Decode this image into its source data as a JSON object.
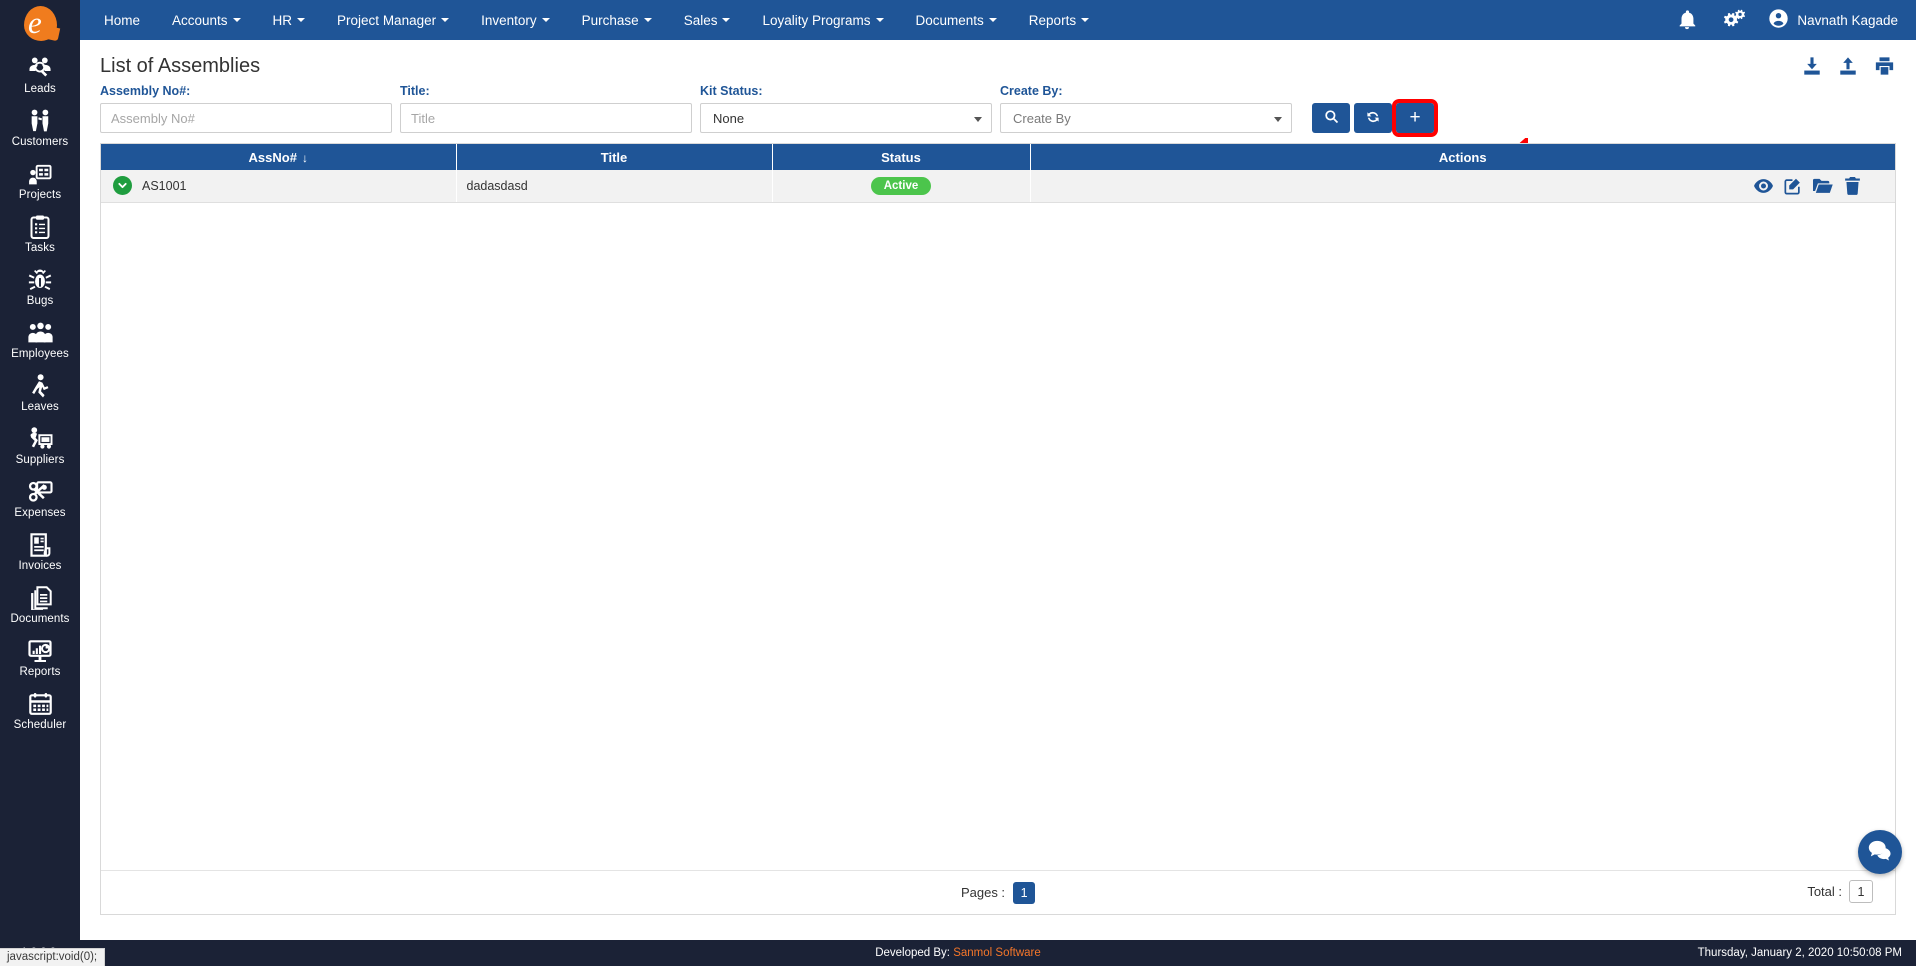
{
  "sidebar": {
    "logo_alt": "company-logo",
    "items": [
      {
        "label": "Leads",
        "icon": "leads-icon"
      },
      {
        "label": "Customers",
        "icon": "customers-icon"
      },
      {
        "label": "Projects",
        "icon": "projects-icon"
      },
      {
        "label": "Tasks",
        "icon": "tasks-icon"
      },
      {
        "label": "Bugs",
        "icon": "bugs-icon"
      },
      {
        "label": "Employees",
        "icon": "employees-icon"
      },
      {
        "label": "Leaves",
        "icon": "leaves-icon"
      },
      {
        "label": "Suppliers",
        "icon": "suppliers-icon"
      },
      {
        "label": "Expenses",
        "icon": "expenses-icon"
      },
      {
        "label": "Invoices",
        "icon": "invoices-icon"
      },
      {
        "label": "Documents",
        "icon": "documents-icon"
      },
      {
        "label": "Reports",
        "icon": "reports-icon"
      },
      {
        "label": "Scheduler",
        "icon": "scheduler-icon"
      }
    ]
  },
  "topnav": {
    "items": [
      {
        "label": "Home",
        "has_caret": false
      },
      {
        "label": "Accounts",
        "has_caret": true
      },
      {
        "label": "HR",
        "has_caret": true
      },
      {
        "label": "Project Manager",
        "has_caret": true
      },
      {
        "label": "Inventory",
        "has_caret": true
      },
      {
        "label": "Purchase",
        "has_caret": true
      },
      {
        "label": "Sales",
        "has_caret": true
      },
      {
        "label": "Loyality Programs",
        "has_caret": true
      },
      {
        "label": "Documents",
        "has_caret": true
      },
      {
        "label": "Reports",
        "has_caret": true
      }
    ],
    "notification_icon": "bell-icon",
    "settings_icon": "gears-icon",
    "user_name": "Navnath Kagade",
    "user_avatar_icon": "user-circle-icon"
  },
  "page": {
    "title": "List of Assemblies",
    "export_actions": [
      {
        "name": "download-icon"
      },
      {
        "name": "upload-icon"
      },
      {
        "name": "print-icon"
      }
    ]
  },
  "filters": {
    "assembly_no": {
      "label": "Assembly No#:",
      "placeholder": "Assembly No#",
      "value": ""
    },
    "title": {
      "label": "Title:",
      "placeholder": "Title",
      "value": ""
    },
    "kit_status": {
      "label": "Kit Status:",
      "value": "None",
      "options": [
        "None"
      ]
    },
    "create_by": {
      "label": "Create By:",
      "value": "Create By",
      "options": [
        "Create By"
      ]
    },
    "buttons": {
      "search_label": "",
      "refresh_label": "",
      "add_label": "+"
    }
  },
  "table": {
    "columns": [
      {
        "label": "AssNo#",
        "sort": "↓"
      },
      {
        "label": "Title",
        "sort": ""
      },
      {
        "label": "Status",
        "sort": ""
      },
      {
        "label": "Actions",
        "sort": ""
      }
    ],
    "rows": [
      {
        "assno": "AS1001",
        "title": "dadasdasd",
        "status": "Active",
        "status_color": "#4cc54c",
        "expand_icon": "chevron-down-circle-icon",
        "actions": [
          "view-icon",
          "edit-icon",
          "folder-icon",
          "delete-icon"
        ]
      }
    ]
  },
  "pagination": {
    "pages_label": "Pages :",
    "current_page": "1",
    "total_label": "Total :",
    "total_value": "1"
  },
  "chat": {
    "icon": "chat-bubble-icon"
  },
  "footer": {
    "version": "r 1.0.0.0",
    "developed_prefix": "Developed By:",
    "developed_by": "Sanmol Software",
    "timestamp": "Thursday, January 2, 2020 10:50:08 PM"
  },
  "status_tip": "javascript:void(0);",
  "colors": {
    "nav_blue": "#1f5597",
    "sidebar_dark": "#1b2236",
    "accent_orange": "#f4762a",
    "status_green": "#4cc54c",
    "highlight_red": "#ff0000"
  }
}
